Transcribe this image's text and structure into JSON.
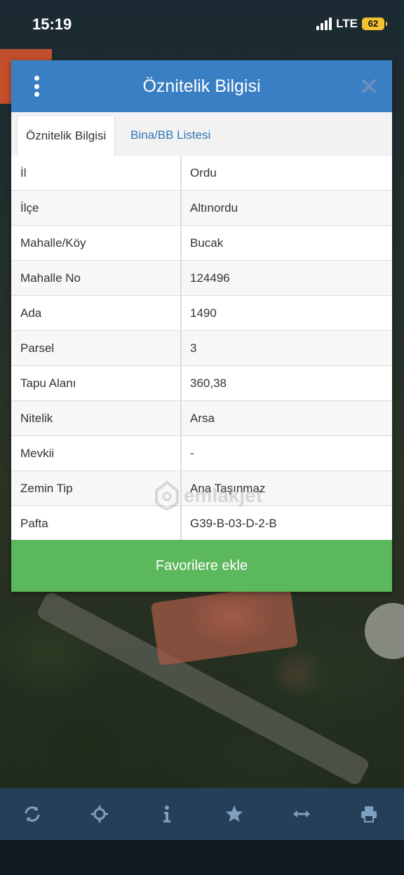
{
  "status_bar": {
    "time": "15:19",
    "network": "LTE",
    "battery": "62"
  },
  "dialog": {
    "title": "Öznitelik Bilgisi",
    "tabs": [
      {
        "label": "Öznitelik Bilgisi",
        "active": true
      },
      {
        "label": "Bina/BB Listesi",
        "active": false
      }
    ],
    "rows": [
      {
        "key": "İl",
        "value": "Ordu"
      },
      {
        "key": "İlçe",
        "value": "Altınordu"
      },
      {
        "key": "Mahalle/Köy",
        "value": "Bucak"
      },
      {
        "key": "Mahalle No",
        "value": "124496"
      },
      {
        "key": "Ada",
        "value": "1490"
      },
      {
        "key": "Parsel",
        "value": "3"
      },
      {
        "key": "Tapu Alanı",
        "value": "360,38"
      },
      {
        "key": "Nitelik",
        "value": "Arsa"
      },
      {
        "key": "Mevkii",
        "value": "-"
      },
      {
        "key": "Zemin Tip",
        "value": "Ana Taşınmaz"
      },
      {
        "key": "Pafta",
        "value": "G39-B-03-D-2-B"
      }
    ],
    "favorite_button": "Favorilere ekle"
  },
  "watermark": "emlakjet",
  "toolbar": {
    "icons": [
      "refresh-icon",
      "locate-icon",
      "info-icon",
      "star-icon",
      "measure-icon",
      "print-icon"
    ]
  },
  "colors": {
    "header": "#3a7fc3",
    "button": "#5cb85c",
    "toolbar": "#253f58",
    "tab_link": "#2f78b7"
  }
}
